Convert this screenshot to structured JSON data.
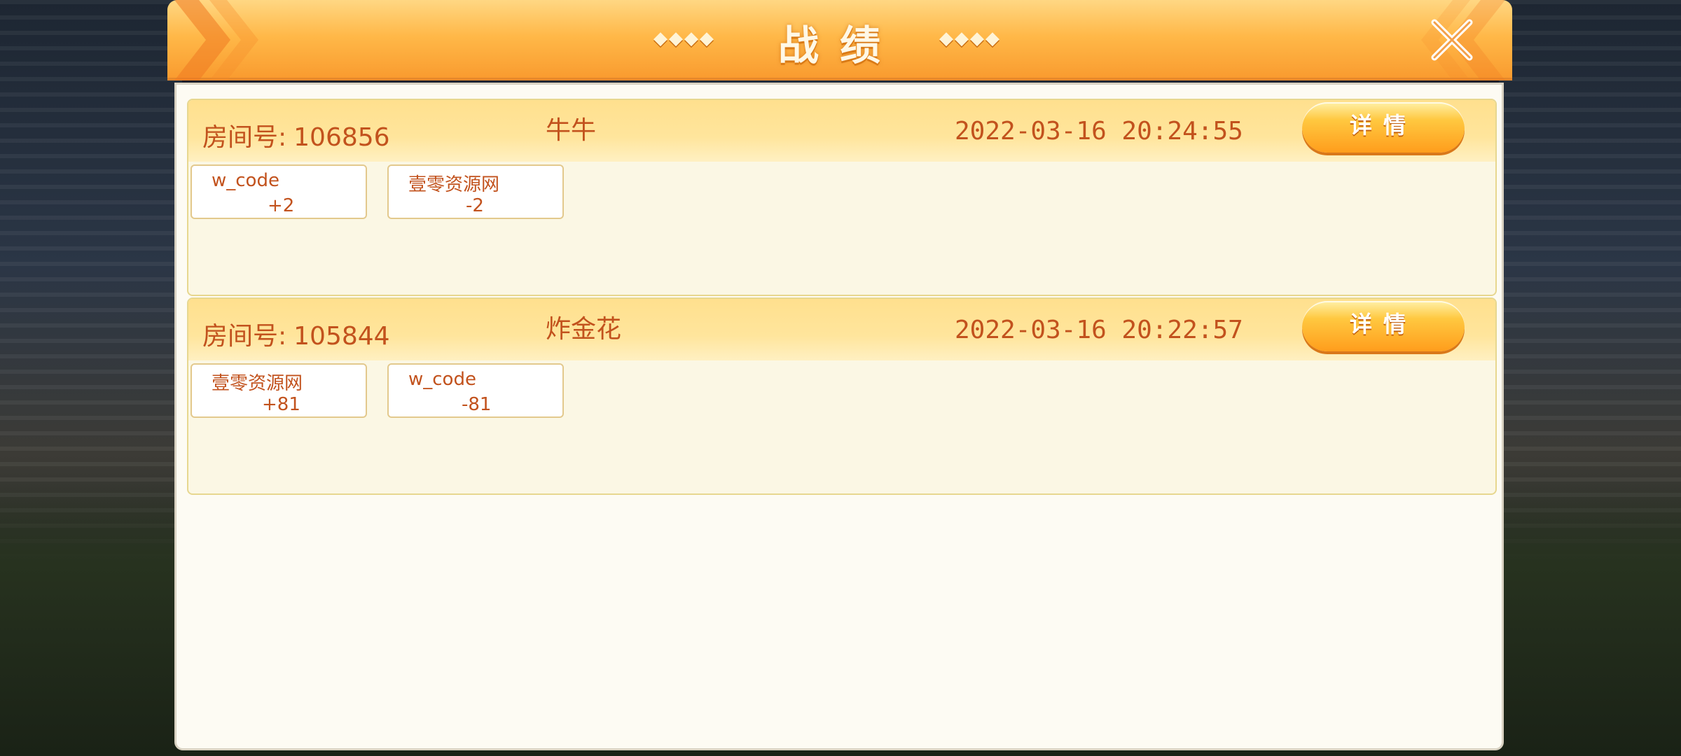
{
  "header": {
    "title": "战绩",
    "deco_left": "◆◆◆◆",
    "deco_right": "◆◆◆◆"
  },
  "records": [
    {
      "room_label": "房间号:",
      "room_number": "106856",
      "game": "牛牛",
      "time": "2022-03-16 20:24:55",
      "details_label": "详情",
      "players": [
        {
          "name": "w_code",
          "score": "+2"
        },
        {
          "name": "壹零资源网",
          "score": "-2"
        }
      ]
    },
    {
      "room_label": "房间号:",
      "room_number": "105844",
      "game": "炸金花",
      "time": "2022-03-16 20:22:57",
      "details_label": "详情",
      "players": [
        {
          "name": "壹零资源网",
          "score": "+81"
        },
        {
          "name": "w_code",
          "score": "-81"
        }
      ]
    }
  ],
  "colors": {
    "text": "#c2521d",
    "header_orange": "#ffb848",
    "panel_bg": "#fdfbf3"
  },
  "icons": {
    "close": "close-x-icon"
  }
}
